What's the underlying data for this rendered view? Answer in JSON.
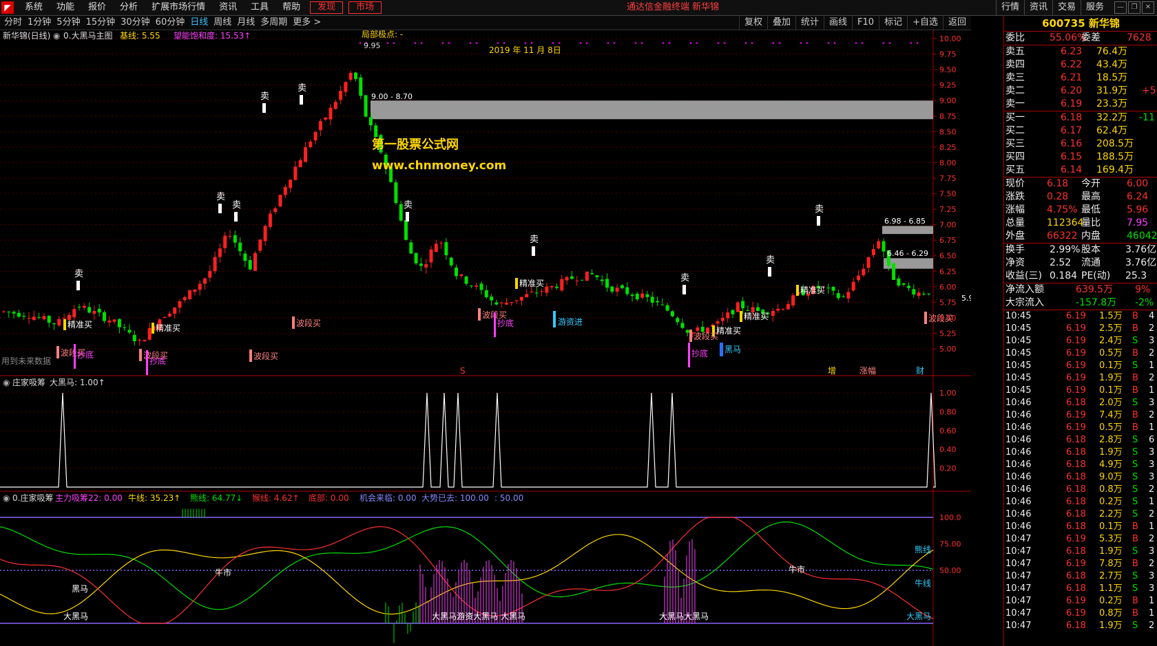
{
  "app": {
    "menu": [
      "系统",
      "功能",
      "报价",
      "分析",
      "扩展市场行情",
      "资讯",
      "工具",
      "帮助",
      "发现",
      "市场"
    ],
    "center_title": "通达信金融终端  新华锦",
    "right_menu": [
      "行情",
      "资讯",
      "交易",
      "服务"
    ]
  },
  "toolbar": {
    "periods": [
      "分时",
      "1分钟",
      "5分钟",
      "15分钟",
      "30分钟",
      "60分钟",
      "日线",
      "周线",
      "月线",
      "多周期",
      "更多 >"
    ],
    "active_period": "日线",
    "tools": [
      "复权",
      "叠加",
      "统计",
      "画线",
      "F10",
      "标记",
      "+自选",
      "返回"
    ]
  },
  "main_chart": {
    "title": "新华锦(日线)",
    "indicator": "0.大黑马主图",
    "baseline_label": "基线: 5.55",
    "saturation_label": "望能饱和度: 15.53↑",
    "local_extreme": "局部极点: -",
    "date_label": "2019 年 11 月 8日",
    "peak_price": "9.95",
    "zone_top_label": "9.00 - 8.70",
    "zone_mid_label": "6.98 - 6.85",
    "zone_low_label": "6.46 - 6.29",
    "current_label": "5.93",
    "watermark_cn": "第一股票公式网",
    "watermark_url": "www.chnmoney.com",
    "future_data": "用到未来数据",
    "y_ticks": [
      "10.00",
      "9.75",
      "9.50",
      "9.25",
      "9.00",
      "8.75",
      "8.50",
      "8.25",
      "8.00",
      "7.75",
      "7.50",
      "7.25",
      "7.00",
      "6.75",
      "6.50",
      "6.25",
      "6.00",
      "5.75",
      "5.50",
      "5.25",
      "5.00"
    ],
    "sell_label": "卖",
    "buy_labels": [
      "精准买",
      "精准买",
      "精准买",
      "精准买",
      "精准买",
      "精准买"
    ],
    "wave_labels": [
      "波段买",
      "波段买",
      "波段买",
      "波段买",
      "波段买",
      "波段买",
      "波段买"
    ],
    "bottom_labels": [
      "抄底",
      "抄底",
      "抄底",
      "抄底"
    ],
    "cash_label": "游资进",
    "horse_label": "黑马",
    "bottom_tags": [
      "S",
      "增",
      "涨幅",
      "财"
    ]
  },
  "panel2": {
    "title": "庄家吸筹",
    "value": "大黑马: 1.00↑",
    "y_ticks": [
      "1.00",
      "0.80",
      "0.60",
      "0.40",
      "0.20"
    ]
  },
  "panel3": {
    "title": "0.庄家吸筹",
    "items": [
      {
        "text": "主力吸筹22: 0.00",
        "color": "#ff40ff"
      },
      {
        "text": "牛线: 35.23↑",
        "color": "#ffd700"
      },
      {
        "text": "熊线: 64.77↓",
        "color": "#00e000"
      },
      {
        "text": "猴线: 4.62↑",
        "color": "#ff3030"
      },
      {
        "text": "底部: 0.00",
        "color": "#ff3030"
      },
      {
        "text": "机会来临: 0.00",
        "color": "#8888ff"
      },
      {
        "text": "大势已去: 100.00",
        "color": "#8888ff"
      },
      {
        "text": ": 50.00",
        "color": "#8888ff"
      }
    ],
    "y_ticks": [
      "100.0",
      "75.00",
      "50.00"
    ],
    "labels": [
      "黑马",
      "大黑马",
      "牛市",
      "牛市",
      "大黑马游资大黑马",
      "大黑马",
      "大黑马大黑马",
      "熊线",
      "牛线",
      "大黑马"
    ]
  },
  "quote": {
    "code": "600735 新华锦",
    "weibi": {
      "label": "委比",
      "val": "55.06%",
      "label2": "委差",
      "val2": "7628"
    },
    "asks": [
      {
        "label": "卖五",
        "price": "6.23",
        "vol": "76.4万",
        "chg": ""
      },
      {
        "label": "卖四",
        "price": "6.22",
        "vol": "43.4万",
        "chg": ""
      },
      {
        "label": "卖三",
        "price": "6.21",
        "vol": "18.5万",
        "chg": ""
      },
      {
        "label": "卖二",
        "price": "6.20",
        "vol": "31.9万",
        "chg": "+5"
      },
      {
        "label": "卖一",
        "price": "6.19",
        "vol": "23.3万",
        "chg": ""
      }
    ],
    "bids": [
      {
        "label": "买一",
        "price": "6.18",
        "vol": "32.2万",
        "chg": "-11"
      },
      {
        "label": "买二",
        "price": "6.17",
        "vol": "62.4万",
        "chg": ""
      },
      {
        "label": "买三",
        "price": "6.16",
        "vol": "208.5万",
        "chg": ""
      },
      {
        "label": "买四",
        "price": "6.15",
        "vol": "188.5万",
        "chg": ""
      },
      {
        "label": "买五",
        "price": "6.14",
        "vol": "169.4万",
        "chg": ""
      }
    ],
    "stats": [
      {
        "l1": "现价",
        "v1": "6.18",
        "c1": "red",
        "l2": "今开",
        "v2": "6.00",
        "c2": "red"
      },
      {
        "l1": "涨跌",
        "v1": "0.28",
        "c1": "red",
        "l2": "最高",
        "v2": "6.24",
        "c2": "red"
      },
      {
        "l1": "涨幅",
        "v1": "4.75%",
        "c1": "red",
        "l2": "最低",
        "v2": "5.96",
        "c2": "red"
      },
      {
        "l1": "总量",
        "v1": "112364",
        "c1": "yel",
        "l2": "量比",
        "v2": "7.95",
        "c2": "mag"
      },
      {
        "l1": "外盘",
        "v1": "66322",
        "c1": "red",
        "l2": "内盘",
        "v2": "46042",
        "c2": "green"
      }
    ],
    "stats2": [
      {
        "l1": "换手",
        "v1": "2.99%",
        "l2": "股本",
        "v2": "3.76亿"
      },
      {
        "l1": "净资",
        "v1": "2.52",
        "l2": "流通",
        "v2": "3.76亿"
      },
      {
        "l1": "收益(三)",
        "v1": "0.184",
        "l2": "PE(动)",
        "v2": "25.3"
      }
    ],
    "flow": [
      {
        "label": "净流入额",
        "val": "639.5万",
        "pct": "9%",
        "color": "red"
      },
      {
        "label": "大宗流入",
        "val": "-157.8万",
        "pct": "-2%",
        "color": "green"
      }
    ],
    "ticks": [
      [
        "10:45",
        "6.19",
        "1.5万",
        "B",
        "4"
      ],
      [
        "10:45",
        "6.19",
        "2.5万",
        "B",
        "2"
      ],
      [
        "10:45",
        "6.19",
        "2.4万",
        "S",
        "3"
      ],
      [
        "10:45",
        "6.19",
        "0.5万",
        "B",
        "2"
      ],
      [
        "10:45",
        "6.19",
        "0.1万",
        "S",
        "1"
      ],
      [
        "10:45",
        "6.19",
        "1.9万",
        "B",
        "2"
      ],
      [
        "10:45",
        "6.19",
        "0.1万",
        "B",
        "1"
      ],
      [
        "10:46",
        "6.18",
        "2.0万",
        "S",
        "3"
      ],
      [
        "10:46",
        "6.19",
        "7.4万",
        "B",
        "2"
      ],
      [
        "10:46",
        "6.19",
        "0.5万",
        "B",
        "1"
      ],
      [
        "10:46",
        "6.18",
        "2.8万",
        "S",
        "6"
      ],
      [
        "10:46",
        "6.18",
        "1.9万",
        "S",
        "3"
      ],
      [
        "10:46",
        "6.18",
        "4.9万",
        "S",
        "3"
      ],
      [
        "10:46",
        "6.18",
        "9.0万",
        "S",
        "3"
      ],
      [
        "10:46",
        "6.18",
        "0.8万",
        "S",
        "2"
      ],
      [
        "10:46",
        "6.18",
        "0.2万",
        "S",
        "1"
      ],
      [
        "10:46",
        "6.18",
        "2.2万",
        "S",
        "2"
      ],
      [
        "10:46",
        "6.18",
        "0.1万",
        "B",
        "1"
      ],
      [
        "10:47",
        "6.19",
        "5.3万",
        "B",
        "2"
      ],
      [
        "10:47",
        "6.18",
        "1.9万",
        "S",
        "3"
      ],
      [
        "10:47",
        "6.19",
        "7.8万",
        "B",
        "2"
      ],
      [
        "10:47",
        "6.18",
        "2.7万",
        "S",
        "3"
      ],
      [
        "10:47",
        "6.18",
        "1.1万",
        "S",
        "3"
      ],
      [
        "10:47",
        "6.19",
        "0.2万",
        "B",
        "1"
      ],
      [
        "10:47",
        "6.19",
        "0.8万",
        "B",
        "1"
      ],
      [
        "10:47",
        "6.18",
        "1.9万",
        "S",
        "2"
      ]
    ]
  }
}
